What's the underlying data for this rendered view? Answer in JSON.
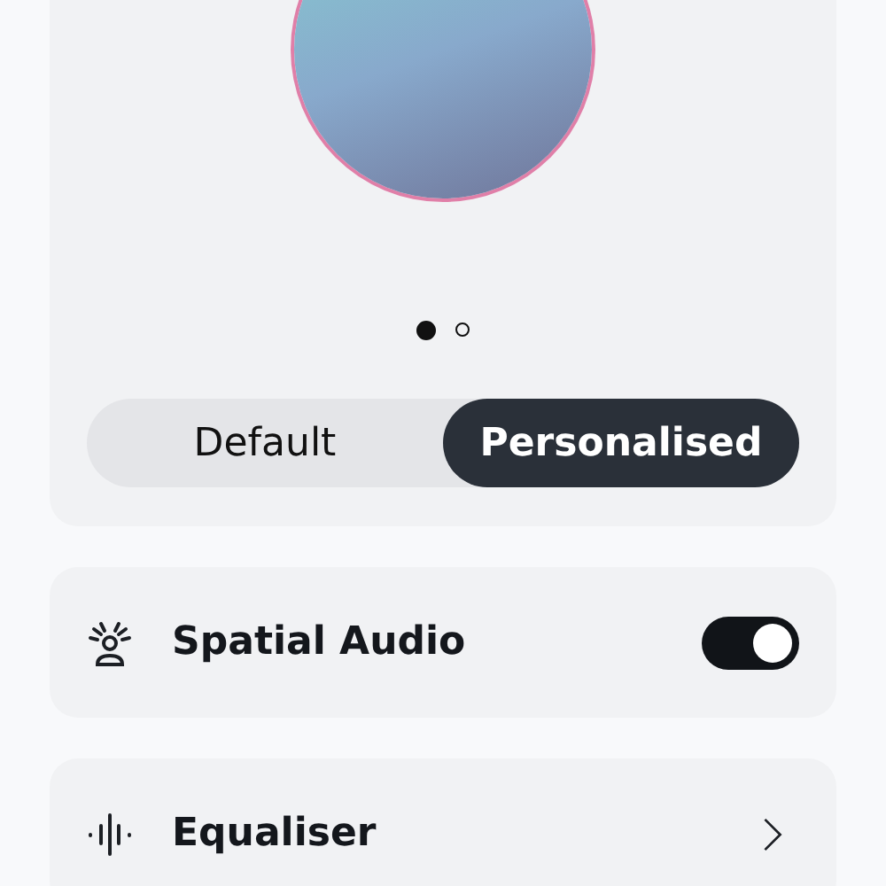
{
  "carousel": {
    "dots": [
      {
        "selected": true
      },
      {
        "selected": false
      }
    ]
  },
  "segments": [
    {
      "label": "Default",
      "selected": false
    },
    {
      "label": "Personalised",
      "selected": true
    }
  ],
  "settings": [
    {
      "kind": "toggle",
      "label": "Spatial Audio",
      "on": true
    },
    {
      "kind": "link",
      "label": "Equaliser"
    }
  ]
}
